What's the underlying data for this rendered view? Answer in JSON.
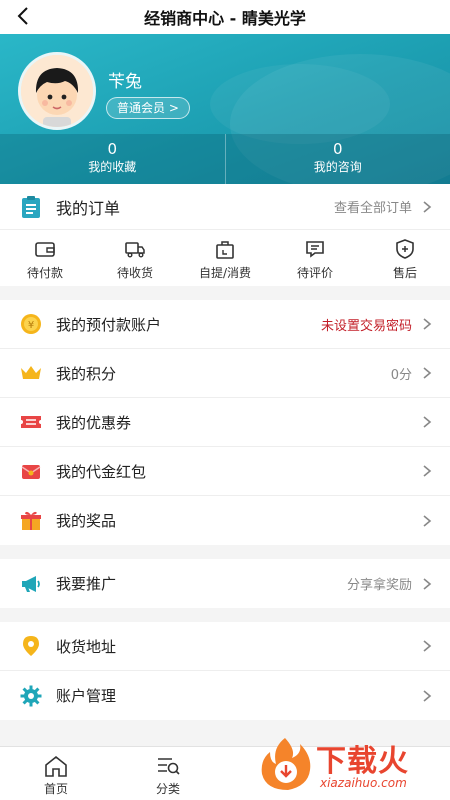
{
  "header": {
    "title": "经销商中心 - 睛美光学"
  },
  "profile": {
    "name": "苄兔",
    "member_label": "普通会员 >"
  },
  "stats": [
    {
      "value": "0",
      "label": "我的收藏"
    },
    {
      "value": "0",
      "label": "我的咨询"
    }
  ],
  "orders": {
    "title": "我的订单",
    "view_all": "查看全部订单",
    "items": [
      {
        "label": "待付款",
        "icon": "wallet-icon"
      },
      {
        "label": "待收货",
        "icon": "truck-icon"
      },
      {
        "label": "自提/消费",
        "icon": "bag-icon"
      },
      {
        "label": "待评价",
        "icon": "comment-icon"
      },
      {
        "label": "售后",
        "icon": "shield-icon"
      }
    ]
  },
  "account_list": [
    {
      "label": "我的预付款账户",
      "value": "未设置交易密码",
      "icon": "coin-icon"
    },
    {
      "label": "我的积分",
      "value": "0分",
      "icon": "crown-icon"
    },
    {
      "label": "我的优惠券",
      "value": "",
      "icon": "coupon-icon"
    },
    {
      "label": "我的代金红包",
      "value": "",
      "icon": "red-envelope-icon"
    },
    {
      "label": "我的奖品",
      "value": "",
      "icon": "gift-icon"
    }
  ],
  "promo_list": [
    {
      "label": "我要推广",
      "value": "分享拿奖励",
      "icon": "megaphone-icon"
    }
  ],
  "settings_list": [
    {
      "label": "收货地址",
      "value": "",
      "icon": "location-icon"
    },
    {
      "label": "账户管理",
      "value": "",
      "icon": "gear-icon"
    }
  ],
  "tabbar": [
    {
      "label": "首页",
      "icon": "home-icon"
    },
    {
      "label": "分类",
      "icon": "category-icon"
    }
  ],
  "watermark": {
    "text": "下载火",
    "sub": "xiazaihuo.com"
  },
  "colors": {
    "accent": "#1fa6b8",
    "alert": "#c3202a",
    "watermark": "#e8452f"
  }
}
